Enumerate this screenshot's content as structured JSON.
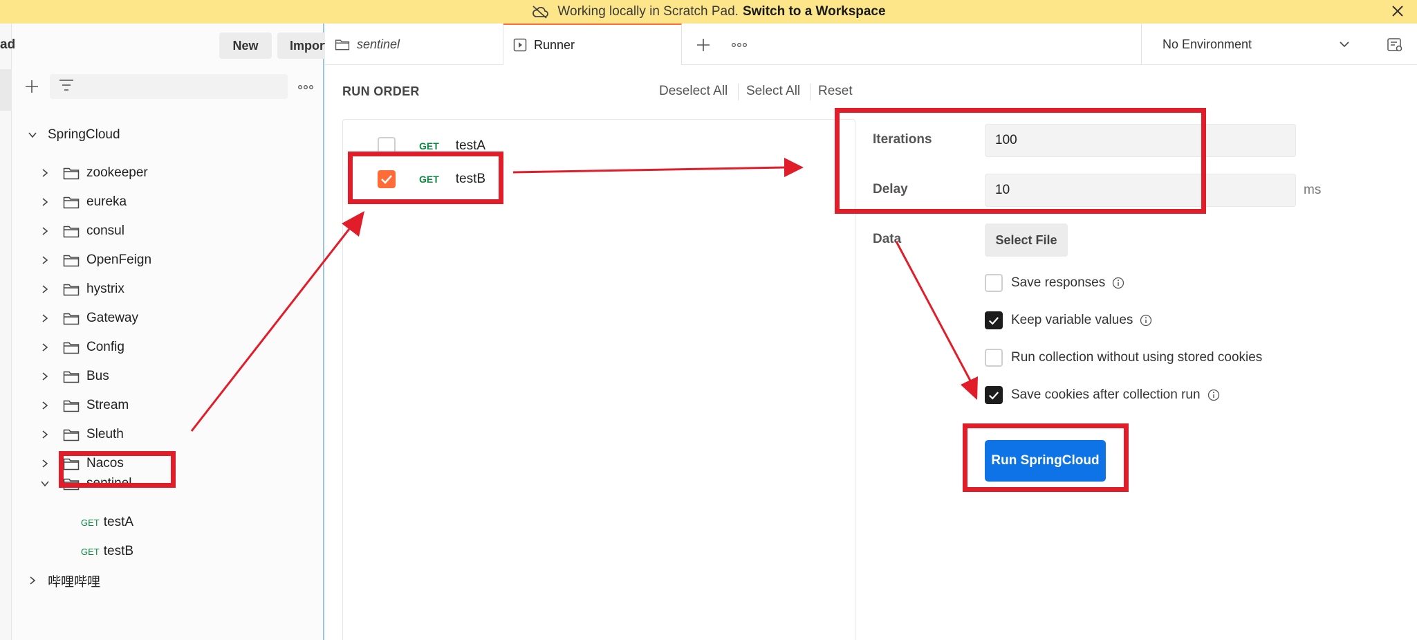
{
  "banner": {
    "text": "Working locally in Scratch Pad.",
    "link": "Switch to a Workspace"
  },
  "sidebar": {
    "title": "ad",
    "new_label": "New",
    "import_label": "Import",
    "tree": {
      "collection": "SpringCloud",
      "folders": [
        "zookeeper",
        "eureka",
        "consul",
        "OpenFeign",
        "hystrix",
        "Gateway",
        "Config",
        "Bus",
        "Stream",
        "Sleuth",
        "Nacos"
      ],
      "open_folder": "sentinel",
      "requests": [
        {
          "method": "GET",
          "name": "testA"
        },
        {
          "method": "GET",
          "name": "testB"
        }
      ],
      "other_collection": "哔哩哔哩"
    }
  },
  "tabs": [
    {
      "label": "sentinel",
      "icon": "folder-icon"
    },
    {
      "label": "Runner",
      "icon": "runner-icon"
    }
  ],
  "environment": {
    "label": "No Environment"
  },
  "run_order": {
    "title": "RUN ORDER",
    "deselect_all": "Deselect All",
    "select_all": "Select All",
    "reset": "Reset",
    "requests": [
      {
        "method": "GET",
        "name": "testA",
        "checked": false
      },
      {
        "method": "GET",
        "name": "testB",
        "checked": true
      }
    ]
  },
  "settings": {
    "iterations_label": "Iterations",
    "iterations_value": "100",
    "delay_label": "Delay",
    "delay_value": "10",
    "delay_unit": "ms",
    "data_label": "Data",
    "select_file_label": "Select File",
    "options": [
      {
        "label": "Save responses",
        "checked": false,
        "info": true
      },
      {
        "label": "Keep variable values",
        "checked": true,
        "info": true
      },
      {
        "label": "Run collection without using stored cookies",
        "checked": false,
        "info": false
      },
      {
        "label": "Save cookies after collection run",
        "checked": true,
        "info": true
      }
    ],
    "run_button_label": "Run SpringCloud"
  },
  "colors": {
    "banner": "#fde68a",
    "accent_orange": "#ff6c37",
    "run_blue": "#0f73e8",
    "annotation_red": "#e11d2a",
    "get_green": "#0b8a3f"
  }
}
